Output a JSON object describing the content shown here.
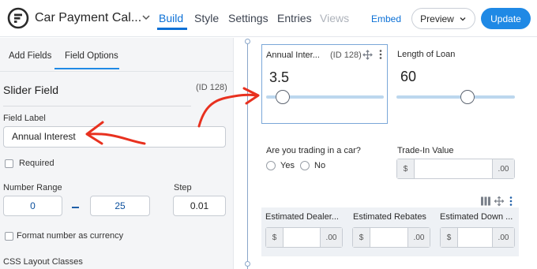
{
  "header": {
    "form_title": "Car Payment Cal...",
    "tabs": [
      {
        "label": "Build"
      },
      {
        "label": "Style"
      },
      {
        "label": "Settings"
      },
      {
        "label": "Entries"
      },
      {
        "label": "Views"
      }
    ],
    "embed_label": "Embed",
    "preview_label": "Preview",
    "update_label": "Update",
    "accent_color": "#1f89e5"
  },
  "left_panel": {
    "tabs": [
      {
        "label": "Add Fields"
      },
      {
        "label": "Field Options"
      }
    ],
    "field_type": "Slider Field",
    "field_id": "(ID 128)",
    "field_label_caption": "Field Label",
    "field_label_value": "Annual Interest",
    "required_label": "Required",
    "number_range_label": "Number Range",
    "range_min": "0",
    "range_max": "25",
    "step_label": "Step",
    "step_value": "0.01",
    "currency_label": "Format number as currency",
    "css_label": "CSS Layout Classes"
  },
  "canvas": {
    "annual_interest": {
      "label": "Annual Inter...",
      "id": "(ID 128)",
      "value": "3.5",
      "slider_fraction": 0.14
    },
    "loan_length": {
      "label": "Length of Loan",
      "value": "60",
      "slider_fraction": 0.6
    },
    "trading_question": "Are you trading in a car?",
    "trade_options": [
      {
        "label": "Yes"
      },
      {
        "label": "No"
      }
    ],
    "trade_in_label": "Trade-In Value",
    "currency_prefix": "$",
    "currency_suffix": ".00",
    "row_fields": [
      {
        "label": "Estimated Dealer..."
      },
      {
        "label": "Estimated Rebates"
      },
      {
        "label": "Estimated Down ..."
      }
    ]
  }
}
